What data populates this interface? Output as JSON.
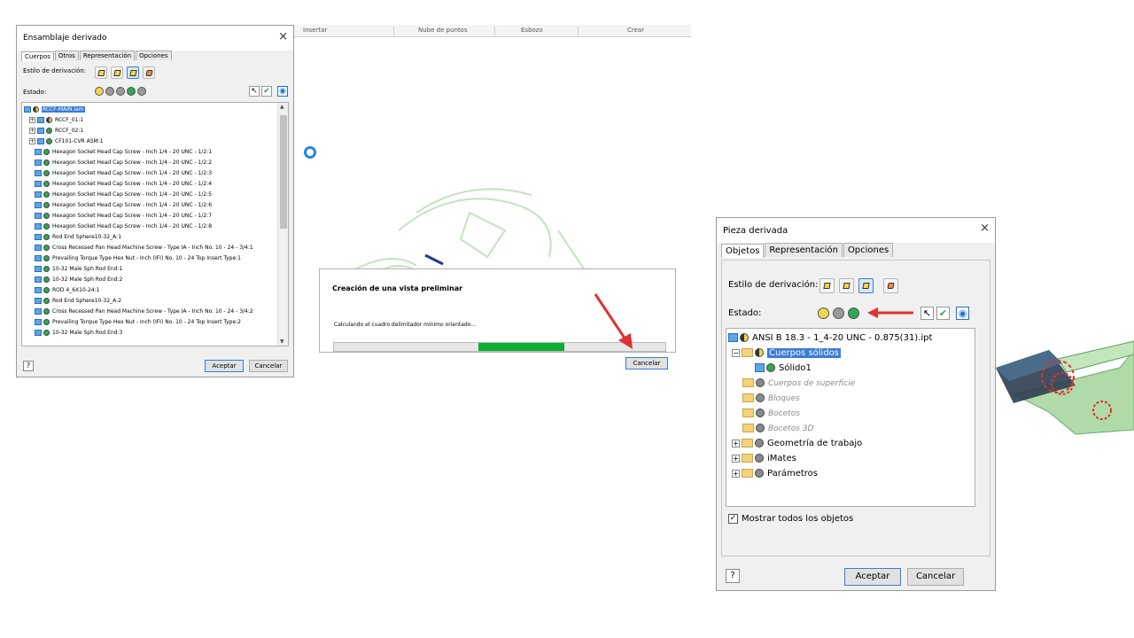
{
  "ribbon": {
    "items": [
      "Insertar",
      "Nube de puntos",
      "Esbozo",
      "Crear"
    ]
  },
  "assembly_dialog": {
    "title": "Ensamblaje derivado",
    "close_glyph": "×",
    "tabs": [
      "Cuerpos",
      "Otros",
      "Representación",
      "Opciones"
    ],
    "style_label": "Estilo de derivación:",
    "state_label": "Estado:",
    "tree": [
      {
        "label": "RCCF-MAIN.iam",
        "kind": "root"
      },
      {
        "label": "RCCF_01:1",
        "kind": "sub"
      },
      {
        "label": "RCCF_02:1",
        "kind": "sub"
      },
      {
        "label": "CF101-CVR ASM:1",
        "kind": "sub"
      },
      {
        "label": "Hexagon Socket Head Cap Screw - Inch 1/4 - 20 UNC - 1/2:1",
        "kind": "part"
      },
      {
        "label": "Hexagon Socket Head Cap Screw - Inch 1/4 - 20 UNC - 1/2:2",
        "kind": "part"
      },
      {
        "label": "Hexagon Socket Head Cap Screw - Inch 1/4 - 20 UNC - 1/2:3",
        "kind": "part"
      },
      {
        "label": "Hexagon Socket Head Cap Screw - Inch 1/4 - 20 UNC - 1/2:4",
        "kind": "part"
      },
      {
        "label": "Hexagon Socket Head Cap Screw - Inch 1/4 - 20 UNC - 1/2:5",
        "kind": "part"
      },
      {
        "label": "Hexagon Socket Head Cap Screw - Inch 1/4 - 20 UNC - 1/2:6",
        "kind": "part"
      },
      {
        "label": "Hexagon Socket Head Cap Screw - Inch 1/4 - 20 UNC - 1/2:7",
        "kind": "part"
      },
      {
        "label": "Hexagon Socket Head Cap Screw - Inch 1/4 - 20 UNC - 1/2:8",
        "kind": "part"
      },
      {
        "label": "Rod End Sphere10-32_A:1",
        "kind": "part"
      },
      {
        "label": "Cross Recessed Pan Head Machine Screw - Type IA - Inch No. 10 - 24 - 3/4:1",
        "kind": "part"
      },
      {
        "label": "Prevailing Torque Type Hex Nut - Inch (IFI) No. 10 - 24 Top Insert Type:1",
        "kind": "part"
      },
      {
        "label": "10-32 Male Sph Rod End:1",
        "kind": "part"
      },
      {
        "label": "10-32 Male Sph Rod End:2",
        "kind": "part"
      },
      {
        "label": "ROD 4_6X10-24:1",
        "kind": "part"
      },
      {
        "label": "Rod End Sphere10-32_A:2",
        "kind": "part"
      },
      {
        "label": "Cross Recessed Pan Head Machine Screw - Type IA - Inch No. 10 - 24 - 3/4:2",
        "kind": "part"
      },
      {
        "label": "Prevailing Torque Type Hex Nut - Inch (IFI) No. 10 - 24 Top Insert Type:2",
        "kind": "part"
      },
      {
        "label": "10-32 Male Sph Rod End:3",
        "kind": "part"
      }
    ],
    "ok_label": "Aceptar",
    "cancel_label": "Cancelar",
    "help_glyph": "?"
  },
  "progress_dialog": {
    "title": "Creación de una vista preliminar",
    "message": "Calculando el cuadro delimitador mínimo orientado...",
    "progress_start": 0.435,
    "progress_end": 0.695,
    "cancel_label": "Cancelar",
    "bar_color": "#0cae32"
  },
  "part_dialog": {
    "title": "Pieza derivada",
    "close_glyph": "×",
    "tabs": [
      "Objetos",
      "Representación",
      "Opciones"
    ],
    "style_label": "Estilo de derivación:",
    "state_label": "Estado:",
    "tree": [
      {
        "label": "ANSI B 18.3 - 1_4-20 UNC - 0.875(31).ipt",
        "kind": "root"
      },
      {
        "label": "Cuerpos sólidos",
        "kind": "folder-sel"
      },
      {
        "label": "Sólido1",
        "kind": "body"
      },
      {
        "label": "Cuerpos de superficie",
        "kind": "folder-dim"
      },
      {
        "label": "Bloques",
        "kind": "folder-dim"
      },
      {
        "label": "Bocetos",
        "kind": "folder-dim"
      },
      {
        "label": "Bocetos 3D",
        "kind": "folder-dim"
      },
      {
        "label": "Geometría de trabajo",
        "kind": "folder-exp"
      },
      {
        "label": "iMates",
        "kind": "folder-exp"
      },
      {
        "label": "Parámetros",
        "kind": "folder-exp"
      }
    ],
    "show_all_label": "Mostrar todos los objetos",
    "ok_label": "Aceptar",
    "cancel_label": "Cancelar",
    "help_glyph": "?"
  },
  "colors": {
    "annotation_arrow": "#e03030",
    "selection": "#3a7bd5",
    "model_green": "#a8d8a0"
  }
}
